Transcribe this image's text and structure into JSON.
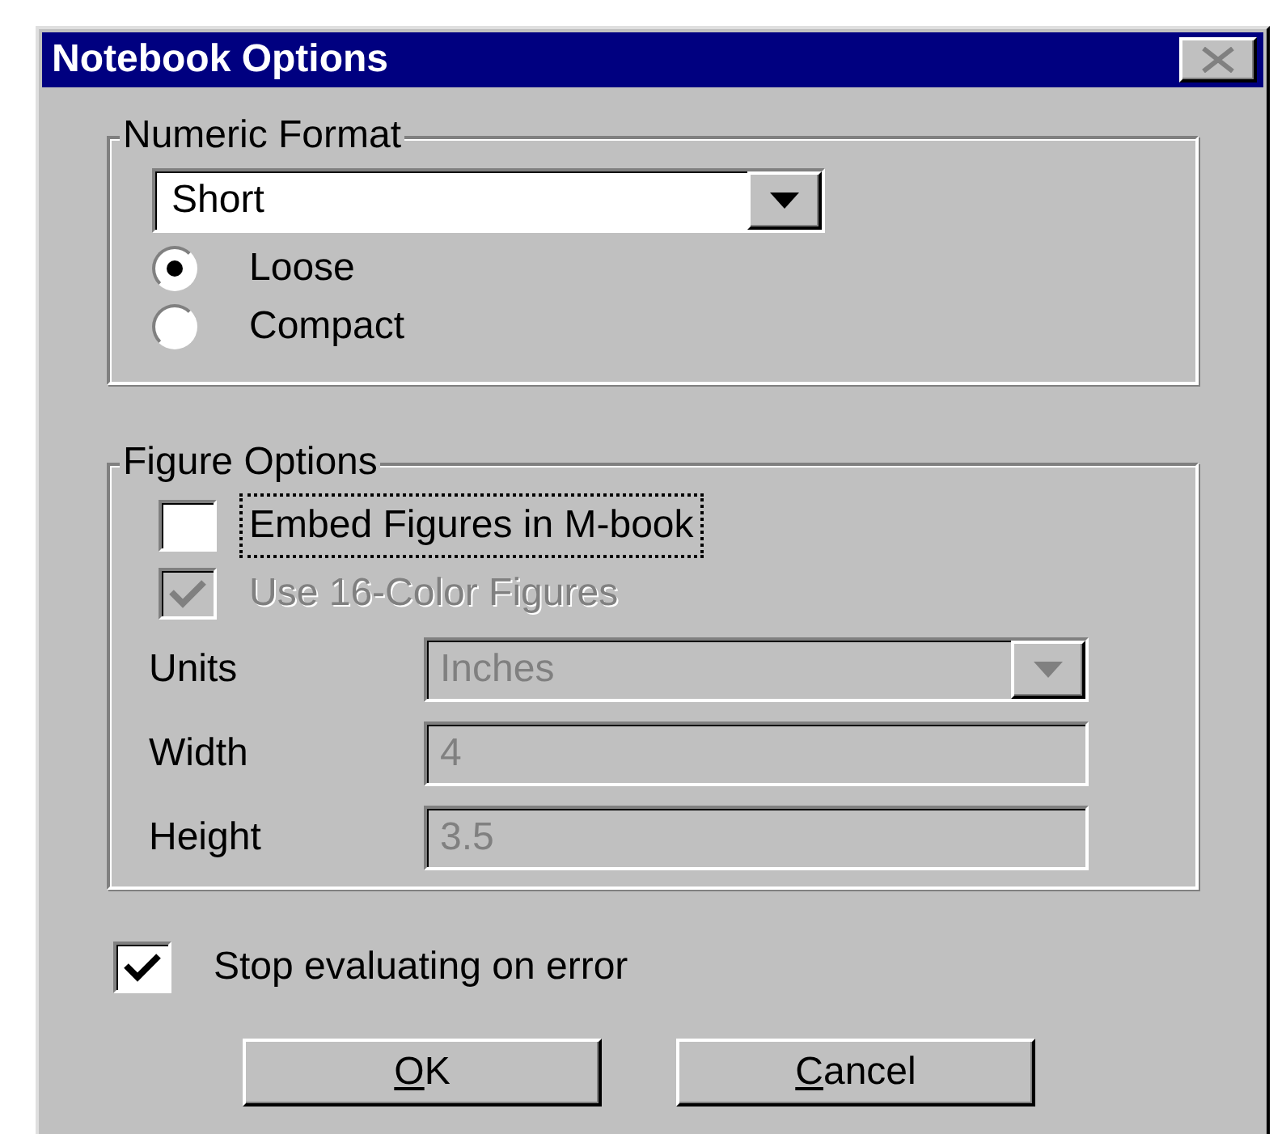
{
  "window": {
    "title": "Notebook Options",
    "close_disabled": true
  },
  "numeric_format": {
    "legend": "Numeric Format",
    "dropdown": {
      "value": "Short",
      "disabled": false
    },
    "radios": [
      {
        "label": "Loose",
        "selected": true
      },
      {
        "label": "Compact",
        "selected": false
      }
    ]
  },
  "figure_options": {
    "legend": "Figure Options",
    "checkboxes": [
      {
        "label": "Embed Figures in M-book",
        "checked": false,
        "disabled": false,
        "focused": true
      },
      {
        "label": "Use 16-Color Figures",
        "checked": true,
        "disabled": true,
        "focused": false
      }
    ],
    "fields": [
      {
        "kind": "dropdown",
        "label": "Units",
        "value": "Inches",
        "disabled": true
      },
      {
        "kind": "text",
        "label": "Width",
        "value": "4",
        "disabled": true
      },
      {
        "kind": "text",
        "label": "Height",
        "value": "3.5",
        "disabled": true
      }
    ]
  },
  "stop_on_error": {
    "label": "Stop evaluating on error",
    "checked": true
  },
  "buttons": [
    {
      "mnemonic": "O",
      "label_rest": "K"
    },
    {
      "mnemonic": "C",
      "label_rest": "ancel"
    }
  ]
}
